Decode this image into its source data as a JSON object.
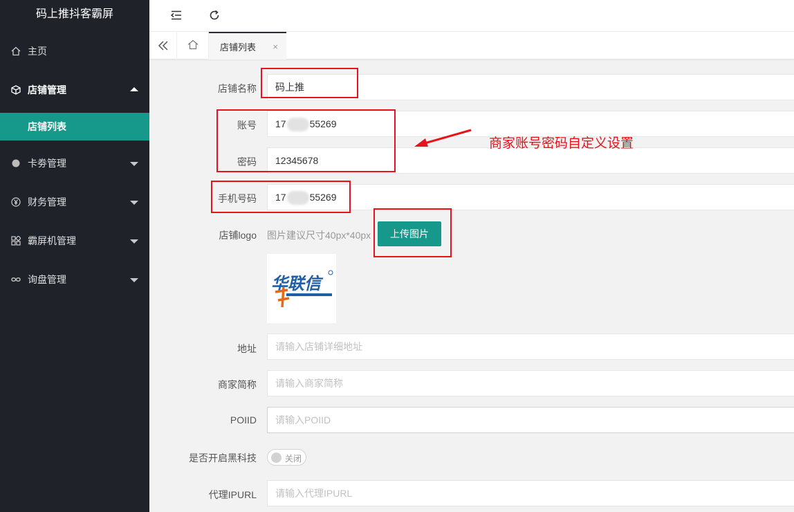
{
  "app": {
    "title": "码上推抖客霸屏"
  },
  "sidebar": {
    "items": [
      {
        "label": "主页",
        "icon": "home-icon"
      },
      {
        "label": "店铺管理",
        "icon": "cube-icon"
      },
      {
        "label": "店铺列表"
      },
      {
        "label": "卡劵管理",
        "icon": "dot-icon"
      },
      {
        "label": "财务管理",
        "icon": "yen-icon"
      },
      {
        "label": "霸屏机管理",
        "icon": "apps-icon"
      },
      {
        "label": "询盘管理",
        "icon": "infinity-icon"
      }
    ]
  },
  "header": {
    "menu_icon": "menu-fold-icon",
    "refresh_icon": "refresh-icon"
  },
  "tabs": {
    "active": "店铺列表",
    "close": "×"
  },
  "form": {
    "shop_name": {
      "label": "店铺名称",
      "value": "码上推"
    },
    "account": {
      "label": "账号",
      "prefix": "17",
      "suffix": "55269"
    },
    "password": {
      "label": "密码",
      "value": "12345678"
    },
    "phone": {
      "label": "手机号码",
      "prefix": "17",
      "suffix": "55269"
    },
    "logo": {
      "label": "店铺logo",
      "hint": "图片建议尺寸40px*40px",
      "button": "上传图片",
      "logo_chars": "华联信"
    },
    "address": {
      "label": "地址",
      "placeholder": "请输入店铺详细地址"
    },
    "merchant_abbr": {
      "label": "商家简称",
      "placeholder": "请输入商家简称"
    },
    "poiid": {
      "label": "POIID",
      "placeholder": "请输入POIID"
    },
    "black_tech": {
      "label": "是否开启黑科技",
      "state": "关闭"
    },
    "proxy": {
      "label": "代理IPURL",
      "placeholder": "请输入代理IPURL"
    }
  },
  "annotation": {
    "text": "商家账号密码自定义设置",
    "color": "#e8131a"
  },
  "colors": {
    "accent": "#16998a",
    "sidebar_bg": "#20222a"
  }
}
